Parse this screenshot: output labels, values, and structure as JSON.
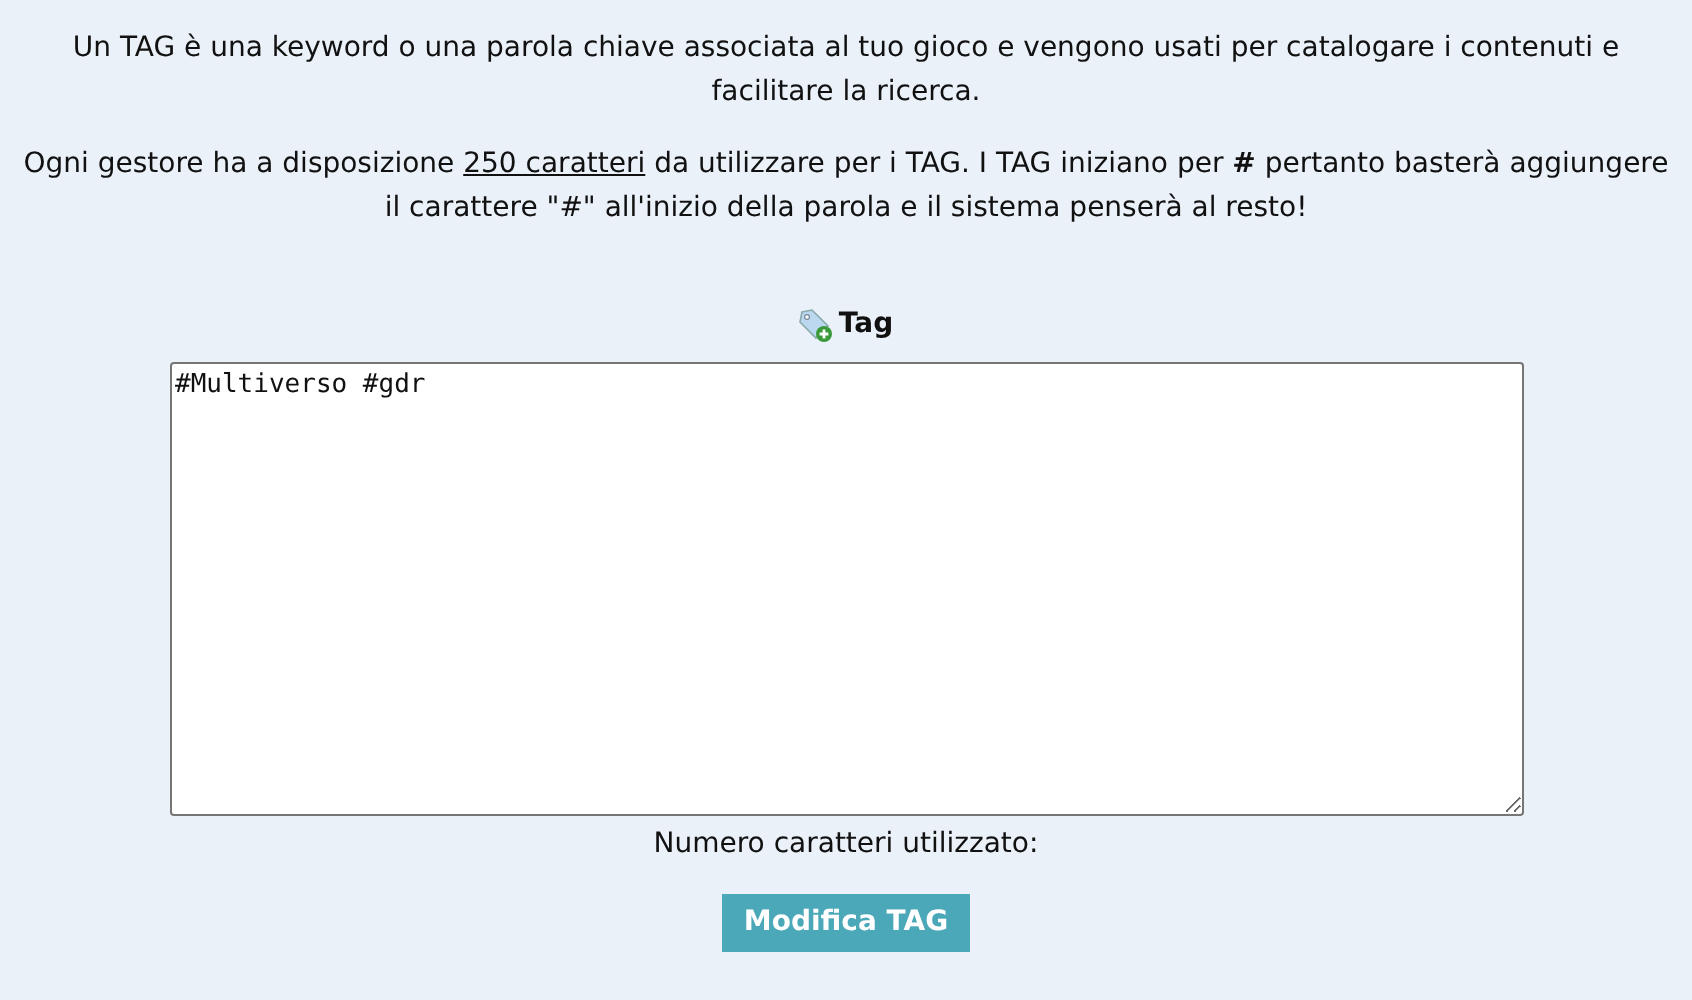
{
  "intro": "Un TAG è una keyword o una parola chiave associata al tuo gioco e vengono usati per catalogare i contenuti e facilitare la ricerca.",
  "info": {
    "before": "Ogni gestore ha a disposizione ",
    "link": "250 caratteri",
    "after": " da utilizzare per i TAG. I TAG iniziano per **#** pertanto basterà aggiungere il carattere \"#\" all'inizio della parola e il sistema penserà al resto!"
  },
  "tag_heading": "Tag",
  "tag_field": {
    "value": "#Multiverso #gdr"
  },
  "counter_label": "Numero caratteri utilizzato:",
  "submit_button": "Modifica TAG"
}
